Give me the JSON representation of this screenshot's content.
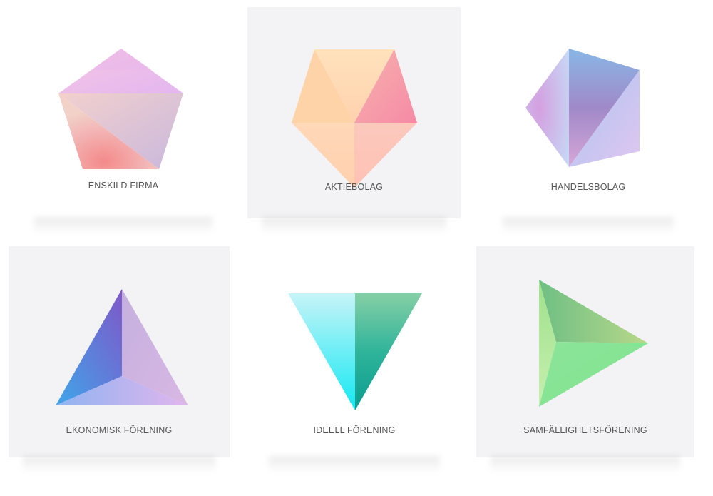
{
  "cards": [
    {
      "label": "ENSKILD FIRMA",
      "icon": "pentagon-icon"
    },
    {
      "label": "AKTIEBOLAG",
      "icon": "pentagon-down-icon"
    },
    {
      "label": "HANDELSBOLAG",
      "icon": "hexagon-icon"
    },
    {
      "label": "EKONOMISK FÖRENING",
      "icon": "triangle-up-icon"
    },
    {
      "label": "IDEELL FÖRENING",
      "icon": "triangle-down-icon"
    },
    {
      "label": "SAMFÄLLIGHETSFÖRENING",
      "icon": "triangle-right-icon"
    }
  ],
  "colors": {
    "card_white": "#ffffff",
    "card_grey": "#f3f3f5",
    "label": "#555555"
  }
}
